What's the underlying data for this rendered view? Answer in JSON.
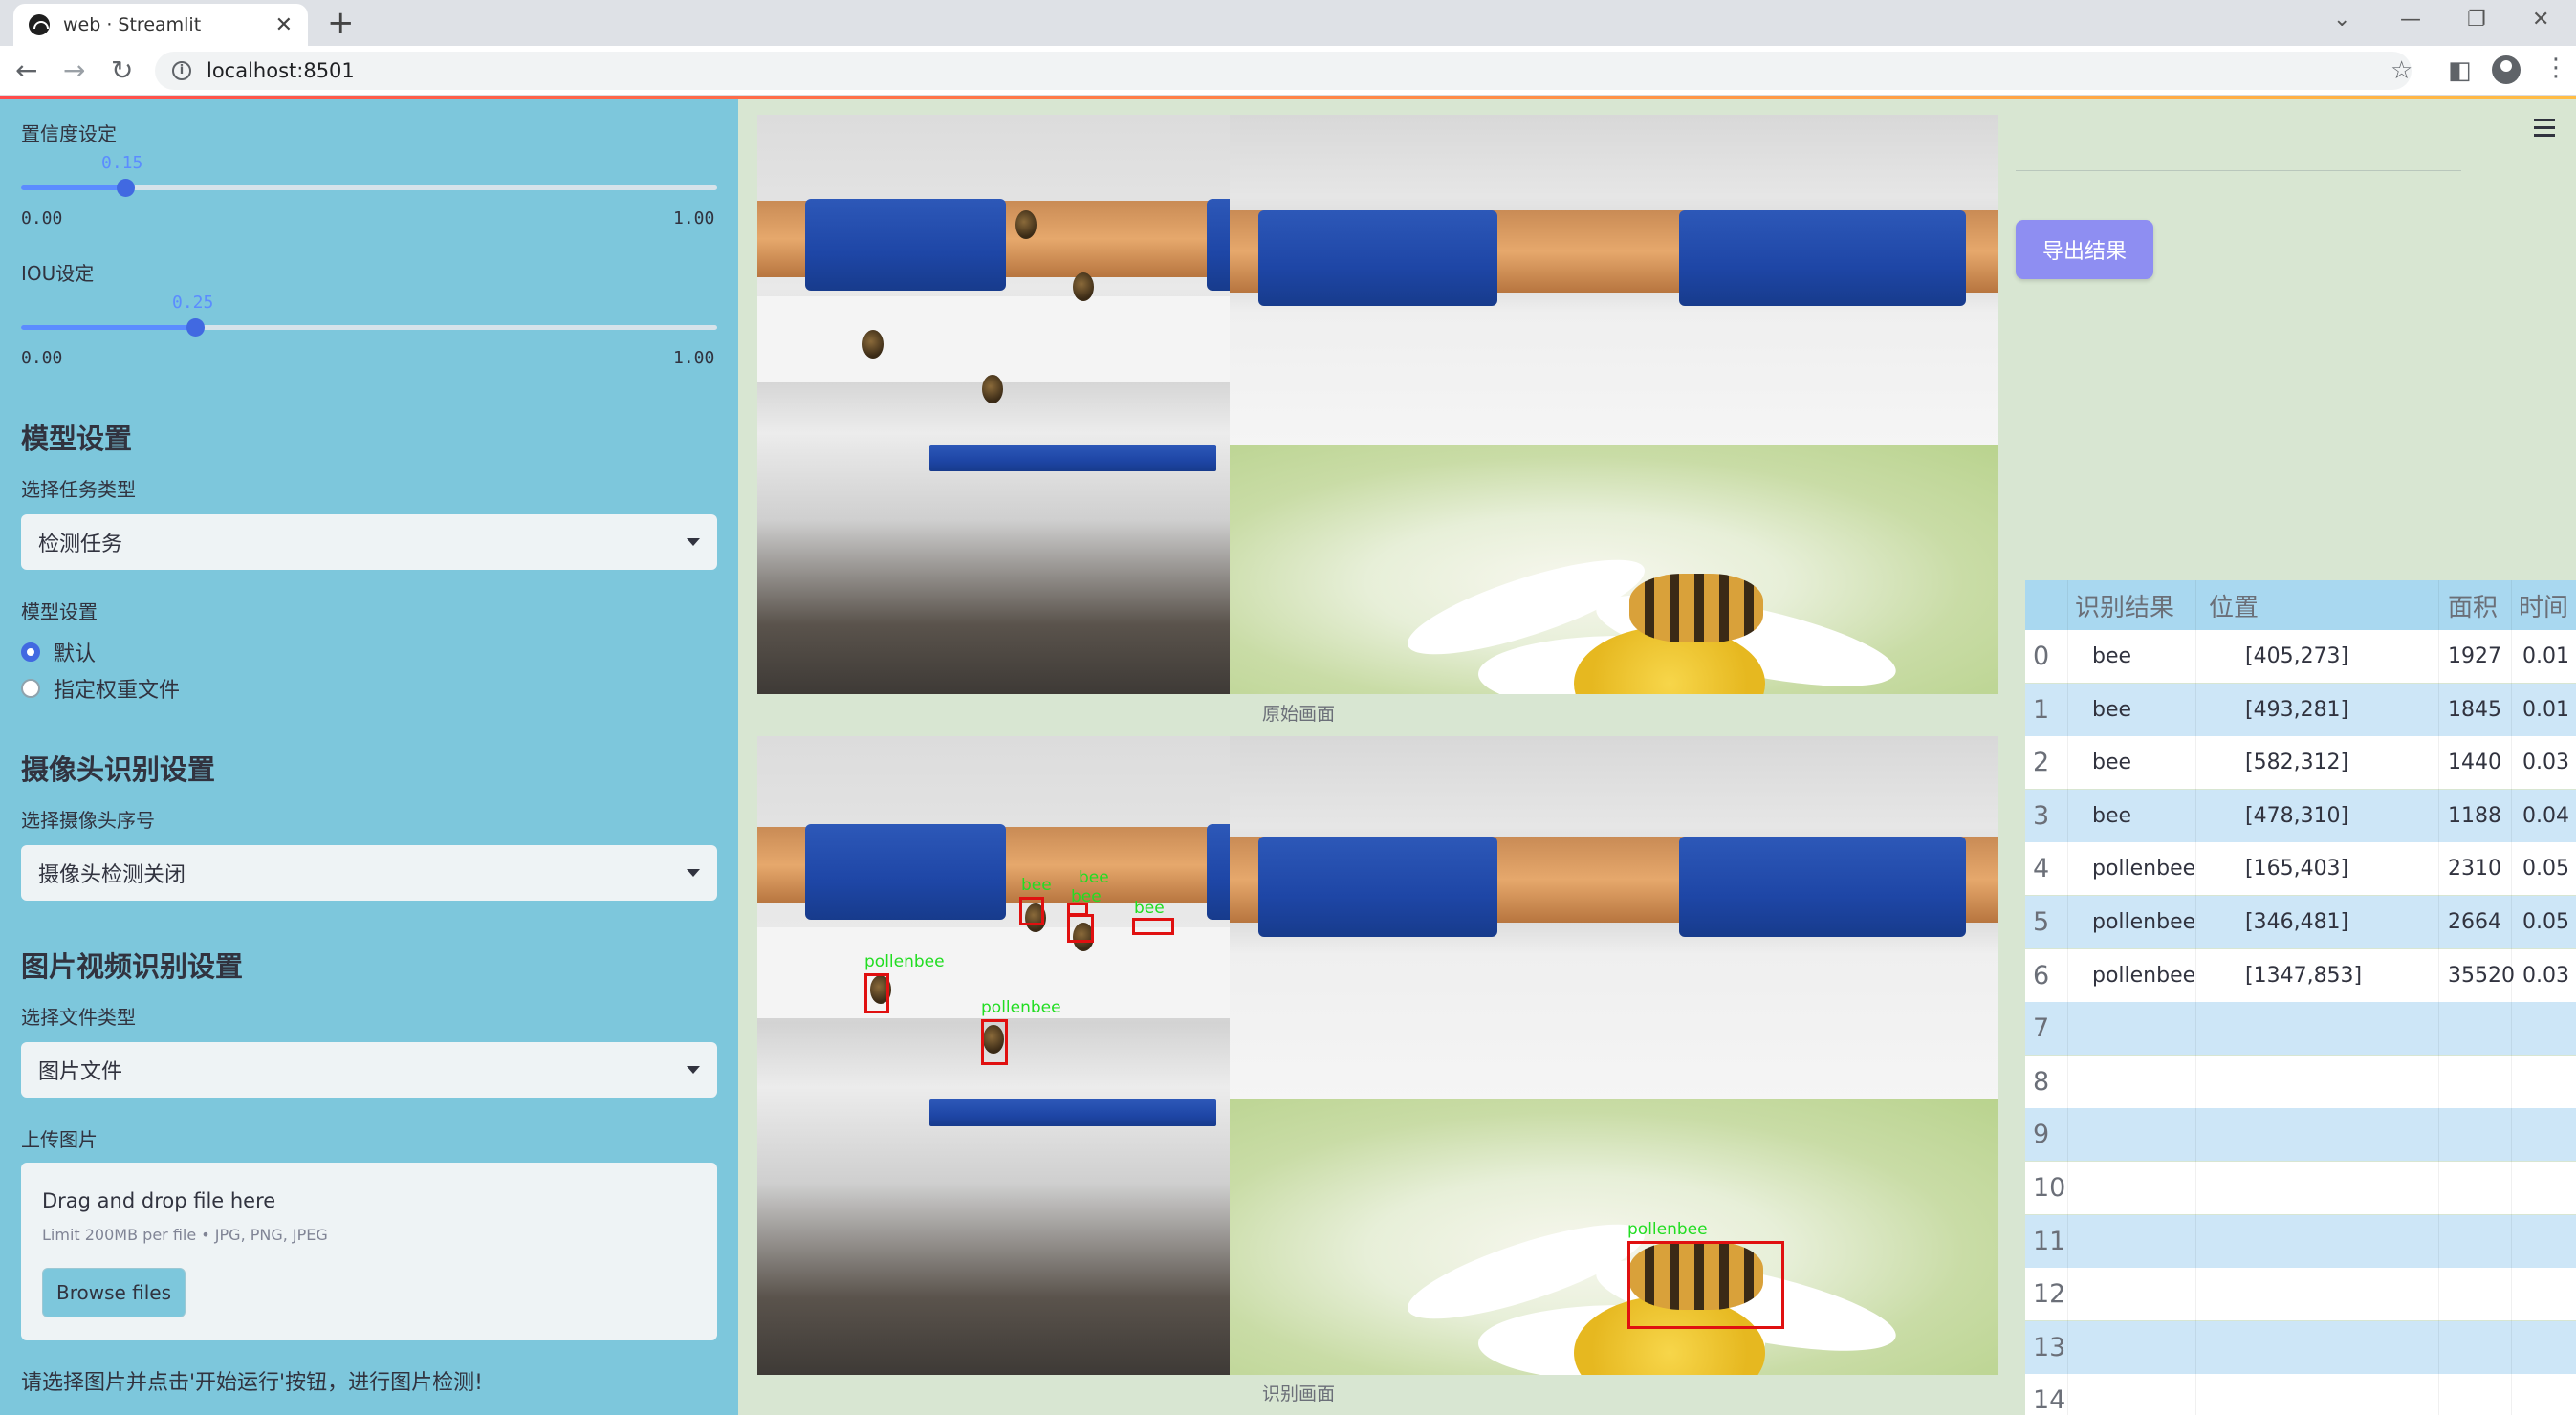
{
  "browser": {
    "tab_title": "web · Streamlit",
    "url": "localhost:8501"
  },
  "sidebar": {
    "confidence": {
      "label": "置信度设定",
      "value": "0.15",
      "min": "0.00",
      "max": "1.00",
      "fraction": 0.15
    },
    "iou": {
      "label": "IOU设定",
      "value": "0.25",
      "min": "0.00",
      "max": "1.00",
      "fraction": 0.25
    },
    "model_section": {
      "heading": "模型设置",
      "task_label": "选择任务类型",
      "task_value": "检测任务",
      "model_label": "模型设置",
      "options": [
        "默认",
        "指定权重文件"
      ],
      "selected": 0
    },
    "camera_section": {
      "heading": "摄像头识别设置",
      "camera_label": "选择摄像头序号",
      "camera_value": "摄像头检测关闭"
    },
    "file_section": {
      "heading": "图片视频识别设置",
      "type_label": "选择文件类型",
      "type_value": "图片文件",
      "upload_label": "上传图片",
      "drop_text": "Drag and drop file here",
      "limit_text": "Limit 200MB per file • JPG, PNG, JPEG",
      "browse_label": "Browse files"
    },
    "hint": "请选择图片并点击'开始运行'按钮，进行图片检测!"
  },
  "main": {
    "original_caption": "原始画面",
    "detected_caption": "识别画面",
    "export_label": "导出结果",
    "detections_labels": [
      "bee",
      "bee",
      "bee",
      "bee",
      "pollenbee",
      "pollenbee",
      "pollenbee"
    ]
  },
  "table": {
    "headers": [
      "识别结果",
      "位置",
      "面积",
      "时间"
    ],
    "rows": [
      {
        "index": "0",
        "result": "bee",
        "position": "[405,273]",
        "area": "1927",
        "time": "0.01"
      },
      {
        "index": "1",
        "result": "bee",
        "position": "[493,281]",
        "area": "1845",
        "time": "0.01"
      },
      {
        "index": "2",
        "result": "bee",
        "position": "[582,312]",
        "area": "1440",
        "time": "0.03"
      },
      {
        "index": "3",
        "result": "bee",
        "position": "[478,310]",
        "area": "1188",
        "time": "0.04"
      },
      {
        "index": "4",
        "result": "pollenbee",
        "position": "[165,403]",
        "area": "2310",
        "time": "0.05"
      },
      {
        "index": "5",
        "result": "pollenbee",
        "position": "[346,481]",
        "area": "2664",
        "time": "0.05"
      },
      {
        "index": "6",
        "result": "pollenbee",
        "position": "[1347,853]",
        "area": "35520",
        "time": "0.03"
      },
      {
        "index": "7",
        "result": "",
        "position": "",
        "area": "",
        "time": ""
      },
      {
        "index": "8",
        "result": "",
        "position": "",
        "area": "",
        "time": ""
      },
      {
        "index": "9",
        "result": "",
        "position": "",
        "area": "",
        "time": ""
      },
      {
        "index": "10",
        "result": "",
        "position": "",
        "area": "",
        "time": ""
      },
      {
        "index": "11",
        "result": "",
        "position": "",
        "area": "",
        "time": ""
      },
      {
        "index": "12",
        "result": "",
        "position": "",
        "area": "",
        "time": ""
      },
      {
        "index": "13",
        "result": "",
        "position": "",
        "area": "",
        "time": ""
      },
      {
        "index": "14",
        "result": "",
        "position": "",
        "area": "",
        "time": ""
      }
    ]
  },
  "colors": {
    "sidebar_bg": "#7dc7dc",
    "main_bg": "#d8e6d2",
    "accent": "#4169e1",
    "export_button": "#8e8ef2",
    "box_red": "#e01010",
    "label_green": "#22dd22"
  }
}
